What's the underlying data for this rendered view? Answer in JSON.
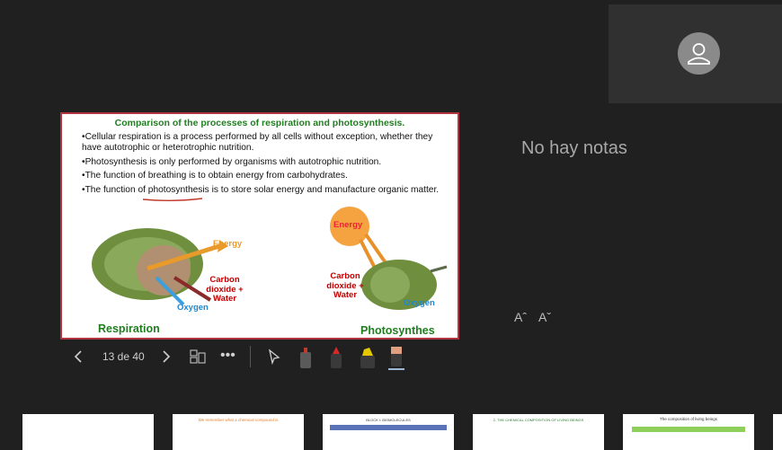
{
  "slide": {
    "title": "Comparison of the processes of respiration and photosynthesis.",
    "bullets": [
      "•Cellular respiration is a process performed by all cells without exception, whether they have autotrophic or heterotrophic nutrition.",
      "•Photosynthesis is only performed by organisms with autotrophic nutrition.",
      "•The function of breathing is to obtain energy from carbohydrates.",
      "•The function of photosynthesis is to store solar energy and manufacture organic matter."
    ],
    "left_labels": {
      "energy": "Energy",
      "co2": "Carbon dioxide + Water",
      "oxygen": "Oxygen"
    },
    "right_labels": {
      "energy": "Energy",
      "co2": "Carbon dioxide + Water",
      "oxygen": "Oxygen"
    },
    "caption_left": "Respiration",
    "caption_right": "Photosynthes"
  },
  "controls": {
    "page_indicator": "13 de 40",
    "prev_icon": "chevron-left-icon",
    "next_icon": "chevron-right-icon"
  },
  "notes": {
    "empty_text": "No hay notas",
    "font_increase": "Aˆ",
    "font_decrease": "Aˇ"
  },
  "thumbnails": [
    {
      "title": ""
    },
    {
      "title": "We remember what a chemical compound is"
    },
    {
      "title": "BLOCK I: BIOMOLECULES"
    },
    {
      "title": "2. THE CHEMICAL COMPOSITION OF LIVING BEINGS"
    },
    {
      "title": "The composition of living beings"
    },
    {
      "title": ""
    }
  ],
  "colors": {
    "accent_green": "#1f7f1f",
    "slide_border": "#b1343f",
    "label_red": "#c00000",
    "label_blue": "#1e88d0"
  }
}
